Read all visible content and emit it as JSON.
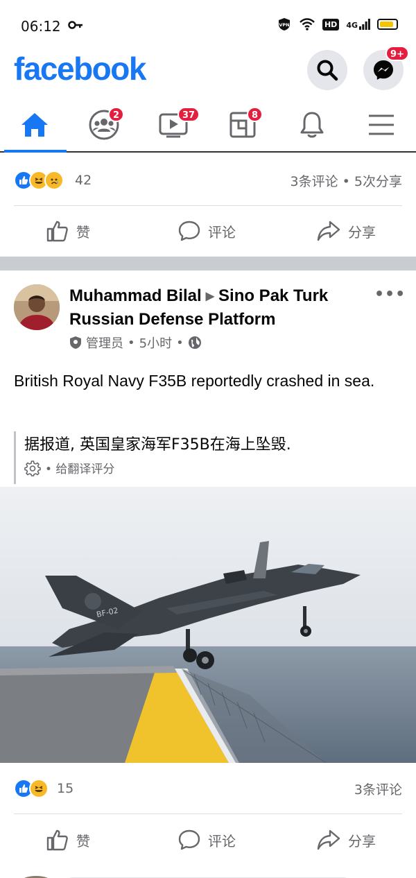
{
  "status_bar": {
    "time": "06:12",
    "vpn_label": "VPN",
    "hd_label": "HD",
    "network_label": "4G",
    "battery_level": 0.85,
    "battery_color": "#f5c400"
  },
  "header": {
    "logo_text": "facebook",
    "brand_color": "#1877f2",
    "messenger_badge": "9+"
  },
  "tabs": [
    {
      "name": "home",
      "icon": "home-icon",
      "active": true,
      "badge": ""
    },
    {
      "name": "groups",
      "icon": "groups-icon",
      "active": false,
      "badge": "2"
    },
    {
      "name": "watch",
      "icon": "watch-icon",
      "active": false,
      "badge": "37"
    },
    {
      "name": "pages",
      "icon": "pages-icon",
      "active": false,
      "badge": "8"
    },
    {
      "name": "notifications",
      "icon": "bell-icon",
      "active": false,
      "badge": ""
    },
    {
      "name": "menu",
      "icon": "menu-icon",
      "active": false,
      "badge": ""
    }
  ],
  "prev_post": {
    "reaction_count": "42",
    "stats": "3条评论 • 5次分享",
    "actions": {
      "like": "赞",
      "comment": "评论",
      "share": "分享"
    }
  },
  "post": {
    "author": "Muhammad Bilal",
    "group": "Sino Pak Turk Russian Defense Platform",
    "role": "管理员",
    "time": "5小时",
    "separator": "•",
    "text": "British Royal Navy F35B reportedly crashed in sea.",
    "translation": "据报道, 英国皇家海军F35B在海上坠毁.",
    "translation_rate": "• 给翻译评分",
    "image_alt": "F-35B jet taking off from a carrier deck over the sea",
    "aircraft_marking": "BF-02",
    "reaction_count": "15",
    "stats": "3条评论",
    "actions": {
      "like": "赞",
      "comment": "评论",
      "share": "分享"
    }
  }
}
